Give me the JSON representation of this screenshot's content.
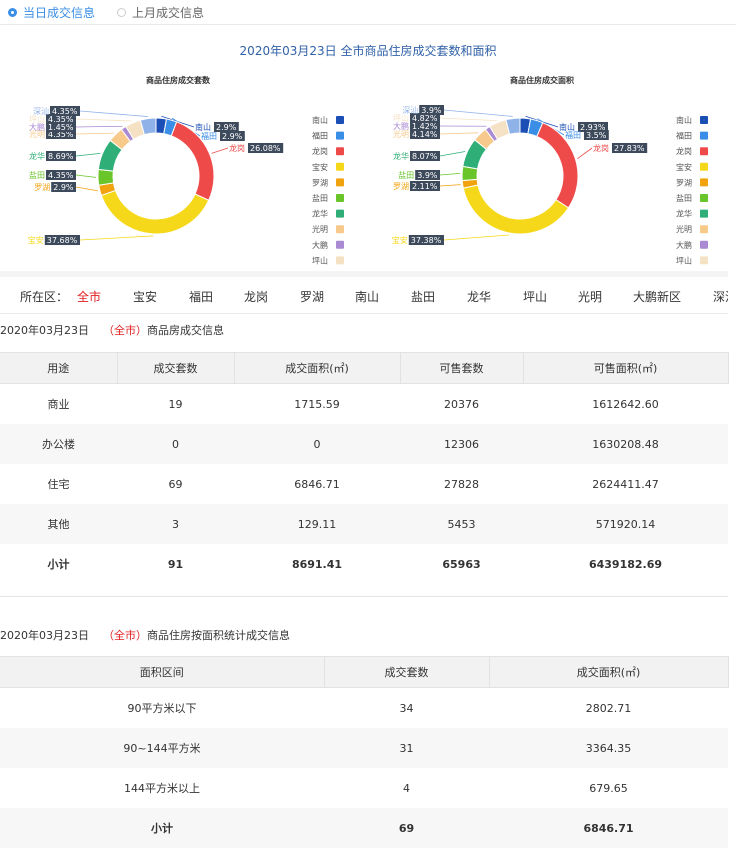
{
  "tabs": [
    {
      "label": "当日成交信息",
      "active": true
    },
    {
      "label": "上月成交信息",
      "active": false
    }
  ],
  "chart_title": "2020年03月23日 全市商品住房成交套数和面积",
  "chart_data": [
    {
      "type": "pie",
      "title": "商品住房成交套数",
      "categories": [
        "南山",
        "福田",
        "龙岗",
        "宝安",
        "罗湖",
        "盐田",
        "龙华",
        "光明",
        "大鹏",
        "坪山",
        "深汕"
      ],
      "values": [
        2.9,
        2.9,
        26.08,
        37.68,
        2.9,
        4.35,
        8.69,
        4.35,
        1.45,
        4.35,
        4.35
      ],
      "labels": [
        "2.9%",
        "2.9%",
        "26.08%",
        "37.68%",
        "2.9%",
        "4.35%",
        "8.69%",
        "4.35%",
        "1.45%",
        "4.35%",
        "4.35%"
      ],
      "legend": "right"
    },
    {
      "type": "pie",
      "title": "商品住房成交面积",
      "categories": [
        "南山",
        "福田",
        "龙岗",
        "宝安",
        "罗湖",
        "盐田",
        "龙华",
        "光明",
        "大鹏",
        "坪山",
        "深汕"
      ],
      "values": [
        2.93,
        3.5,
        27.83,
        37.38,
        2.11,
        3.9,
        8.07,
        4.14,
        1.42,
        4.82,
        3.9
      ],
      "labels": [
        "2.93%",
        "3.5%",
        "27.83%",
        "37.38%",
        "2.11%",
        "3.9%",
        "8.07%",
        "4.14%",
        "1.42%",
        "4.82%",
        "3.9%"
      ],
      "legend": "right"
    }
  ],
  "colors": {
    "南山": "#1b4fb5",
    "福田": "#3a8ee6",
    "龙岗": "#ef4a4a",
    "宝安": "#f6d81a",
    "罗湖": "#f0a20f",
    "盐田": "#6ac52a",
    "龙华": "#2fae78",
    "光明": "#f7c98a",
    "大鹏": "#a98ad3",
    "坪山": "#f5e2c4",
    "深汕": "#8fb2e8"
  },
  "district_filter": {
    "label": "所在区：",
    "options": [
      "全市",
      "宝安",
      "福田",
      "龙岗",
      "罗湖",
      "南山",
      "盐田",
      "龙华",
      "坪山",
      "光明",
      "大鹏新区",
      "深汕"
    ],
    "active": "全市"
  },
  "table1": {
    "date": "2020年03月23日",
    "district": "（全市）",
    "suffix": "商品房成交信息",
    "headers": [
      "用途",
      "成交套数",
      "成交面积(㎡)",
      "可售套数",
      "可售面积(㎡)"
    ],
    "rows": [
      [
        "商业",
        "19",
        "1715.59",
        "20376",
        "1612642.60"
      ],
      [
        "办公楼",
        "0",
        "0",
        "12306",
        "1630208.48"
      ],
      [
        "住宅",
        "69",
        "6846.71",
        "27828",
        "2624411.47"
      ],
      [
        "其他",
        "3",
        "129.11",
        "5453",
        "571920.14"
      ],
      [
        "小计",
        "91",
        "8691.41",
        "65963",
        "6439182.69"
      ]
    ]
  },
  "table2": {
    "date": "2020年03月23日",
    "district": "（全市）",
    "suffix": "商品住房按面积统计成交信息",
    "headers": [
      "面积区间",
      "成交套数",
      "成交面积(㎡)"
    ],
    "rows": [
      [
        "90平方米以下",
        "34",
        "2802.71"
      ],
      [
        "90~144平方米",
        "31",
        "3364.35"
      ],
      [
        "144平方米以上",
        "4",
        "679.65"
      ],
      [
        "小计",
        "69",
        "6846.71"
      ]
    ]
  }
}
